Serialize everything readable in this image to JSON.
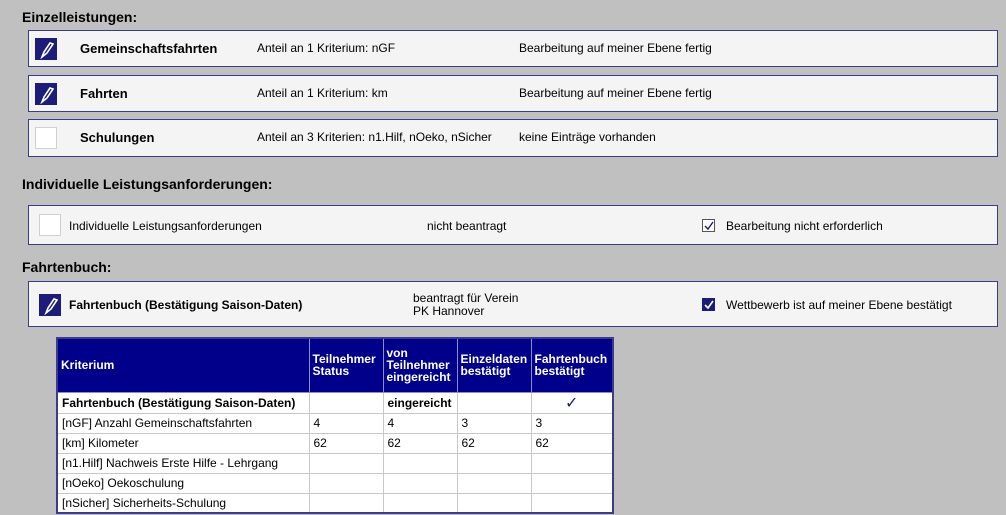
{
  "sections": {
    "einzel_title": "Einzelleistungen:",
    "individuell_title": "Individuelle Leistungsanforderungen:",
    "fahrtenbuch_title": "Fahrtenbuch:"
  },
  "einzelleistungen": [
    {
      "name": "Gemeinschaftsfahrten",
      "anteil": "Anteil an 1 Kriterium: nGF",
      "status": "Bearbeitung auf meiner Ebene fertig",
      "icon": "pen-icon"
    },
    {
      "name": "Fahrten",
      "anteil": "Anteil an 1 Kriterium: km",
      "status": "Bearbeitung auf meiner Ebene fertig",
      "icon": "pen-icon"
    },
    {
      "name": "Schulungen",
      "anteil": "Anteil an 3 Kriterien: n1.Hilf, nOeko, nSicher",
      "status": "keine Einträge vorhanden",
      "icon": ""
    }
  ],
  "individuell": {
    "label": "Individuelle Leistungsanforderungen",
    "status": "nicht beantragt",
    "checkbox_label": "Bearbeitung nicht erforderlich",
    "checked": false
  },
  "fahrtenbuch": {
    "label": "Fahrtenbuch (Bestätigung Saison-Daten)",
    "beantragt_line1": "beantragt für Verein",
    "beantragt_line2": "PK Hannover",
    "checkbox_label": "Wettbewerb ist auf meiner Ebene bestätigt",
    "checked": true
  },
  "table": {
    "headers": {
      "kriterium": "Kriterium",
      "teilnehmer_status": [
        "Teilnehmer",
        "Status"
      ],
      "von_teilnehmer": [
        "von",
        "Teilnehmer",
        "eingereicht"
      ],
      "einzeldaten": [
        "Einzeldaten",
        "bestätigt"
      ],
      "fahrtenbuch": [
        "Fahrtenbuch",
        "bestätigt"
      ]
    },
    "rows": [
      {
        "kriterium": "Fahrtenbuch (Bestätigung Saison-Daten)",
        "status": "",
        "eingereicht": "eingereicht",
        "einzeldaten": "",
        "fahrtenbuch": "✓",
        "bold": true
      },
      {
        "kriterium": "[nGF] Anzahl Gemeinschaftsfahrten",
        "status": "4",
        "eingereicht": "4",
        "einzeldaten": "3",
        "fahrtenbuch": "3",
        "bold": false
      },
      {
        "kriterium": "[km] Kilometer",
        "status": "62",
        "eingereicht": "62",
        "einzeldaten": "62",
        "fahrtenbuch": "62",
        "bold": false
      },
      {
        "kriterium": "[n1.Hilf] Nachweis Erste Hilfe - Lehrgang",
        "status": "",
        "eingereicht": "",
        "einzeldaten": "",
        "fahrtenbuch": "",
        "bold": false
      },
      {
        "kriterium": "[nOeko] Oekoschulung",
        "status": "",
        "eingereicht": "",
        "einzeldaten": "",
        "fahrtenbuch": "",
        "bold": false
      },
      {
        "kriterium": "[nSicher] Sicherheits-Schulung",
        "status": "",
        "eingereicht": "",
        "einzeldaten": "",
        "fahrtenbuch": "",
        "bold": false
      }
    ]
  },
  "colors": {
    "background": "#c0c0c0",
    "header_blue": "#00008b",
    "icon_blue": "#1c1c7a",
    "panel_border": "#3b3b8c"
  }
}
